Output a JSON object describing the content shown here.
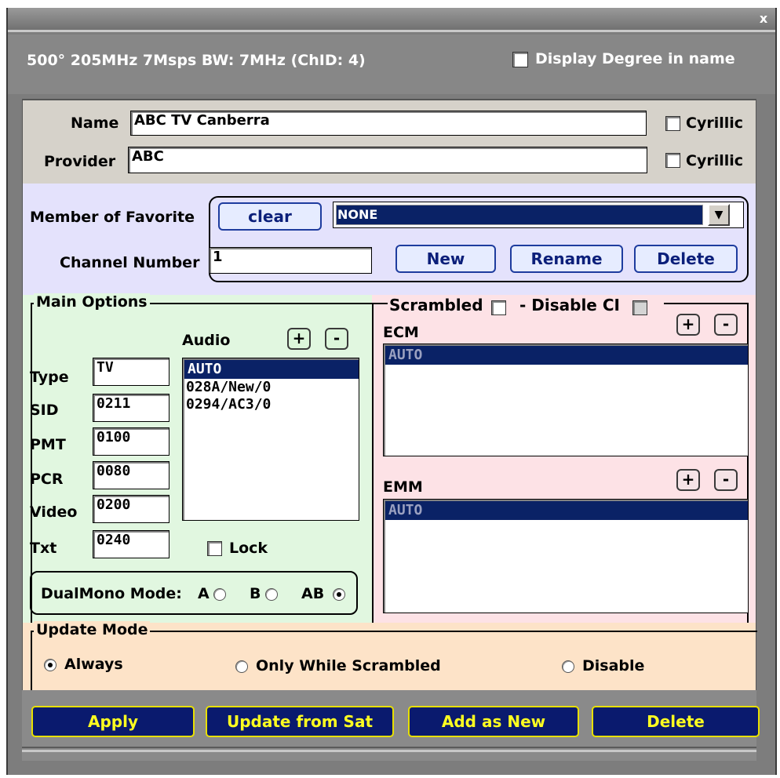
{
  "window": {
    "close_glyph": "x",
    "title": "500° 205MHz 7Msps BW: 7MHz (ChID: 4)",
    "display_degree_label": "Display Degree in name",
    "display_degree_checked": false
  },
  "identity": {
    "name_label": "Name",
    "name_value": "ABC TV Canberra",
    "provider_label": "Provider",
    "provider_value": "ABC",
    "cyrillic_label": "Cyrillic",
    "name_cyrillic_checked": false,
    "provider_cyrillic_checked": false
  },
  "favorite": {
    "member_label": "Member of Favorite",
    "clear_label": "clear",
    "selected": "NONE",
    "channel_number_label": "Channel Number",
    "channel_number_value": "1",
    "new_label": "New",
    "rename_label": "Rename",
    "delete_label": "Delete"
  },
  "main_options": {
    "legend": "Main Options",
    "audio_label": "Audio",
    "plus": "+",
    "minus": "-",
    "fields": [
      {
        "label": "Type",
        "value": "TV"
      },
      {
        "label": "SID",
        "value": "0211"
      },
      {
        "label": "PMT",
        "value": "0100"
      },
      {
        "label": "PCR",
        "value": "0080"
      },
      {
        "label": "Video",
        "value": "0200"
      },
      {
        "label": "Txt",
        "value": "0240"
      }
    ],
    "audio_items": [
      "AUTO",
      "028A/New/0",
      "0294/AC3/0"
    ],
    "audio_selected_index": 0,
    "lock_label": "Lock",
    "lock_checked": false,
    "dualmono_label": "DualMono Mode:",
    "dualmono_options": [
      "A",
      "B",
      "AB"
    ],
    "dualmono_selected": "AB"
  },
  "scrambled": {
    "scrambled_label": "Scrambled",
    "disable_ci_label": "- Disable CI",
    "ecm_label": "ECM",
    "ecm_items": [
      "AUTO"
    ],
    "emm_label": "EMM",
    "emm_items": [
      "AUTO"
    ]
  },
  "update_mode": {
    "legend": "Update Mode",
    "options": [
      "Always",
      "Only While Scrambled",
      "Disable"
    ],
    "selected": "Always"
  },
  "actions": {
    "apply": "Apply",
    "update_from_sat": "Update from Sat",
    "add_as_new": "Add as New",
    "delete": "Delete"
  },
  "colors": {
    "selection_bg": "#0a2266",
    "main_options_bg": "#e1f7e0",
    "scrambled_bg": "#fde2e6",
    "favorite_bg": "#e4e2fc",
    "update_bg": "#fde3c8",
    "action_button_bg": "#0a1a6e",
    "action_button_text": "#ffff20"
  }
}
